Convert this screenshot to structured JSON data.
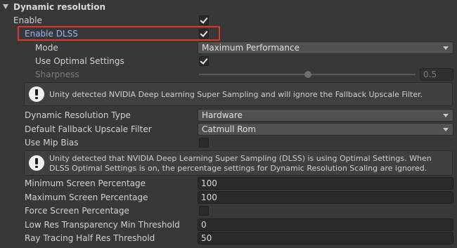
{
  "section": {
    "title": "Dynamic resolution"
  },
  "enable": {
    "label": "Enable",
    "checked": true
  },
  "enable_dlss": {
    "label": "Enable DLSS",
    "checked": true
  },
  "mode": {
    "label": "Mode",
    "value": "Maximum Performance"
  },
  "use_optimal": {
    "label": "Use Optimal Settings",
    "checked": true
  },
  "sharpness": {
    "label": "Sharpness",
    "value": "0.5",
    "fraction": 0.5
  },
  "help1": {
    "text": "Unity detected NVIDIA Deep Learning Super Sampling and will ignore the Fallback Upscale Filter."
  },
  "dyn_res_type": {
    "label": "Dynamic Resolution Type",
    "value": "Hardware"
  },
  "fallback_filter": {
    "label": "Default Fallback Upscale Filter",
    "value": "Catmull Rom"
  },
  "use_mip_bias": {
    "label": "Use Mip Bias",
    "checked": false
  },
  "help2": {
    "text": "Unity detected that NVIDIA Deep Learning Super Sampling (DLSS) is using Optimal Settings. When DLSS Optimal Settings is on, the percentage settings for Dynamic Resolution Scaling are ignored."
  },
  "min_pct": {
    "label": "Minimum Screen Percentage",
    "value": "100"
  },
  "max_pct": {
    "label": "Maximum Screen Percentage",
    "value": "100"
  },
  "force_pct": {
    "label": "Force Screen Percentage",
    "checked": false
  },
  "low_res": {
    "label": "Low Res Transparency Min Threshold",
    "value": "0"
  },
  "ray_tracing": {
    "label": "Ray Tracing Half Res Threshold",
    "value": "50"
  },
  "colors": {
    "background": "#383838",
    "highlight": "#e0352b",
    "dlss_label": "#8fb8f5"
  }
}
